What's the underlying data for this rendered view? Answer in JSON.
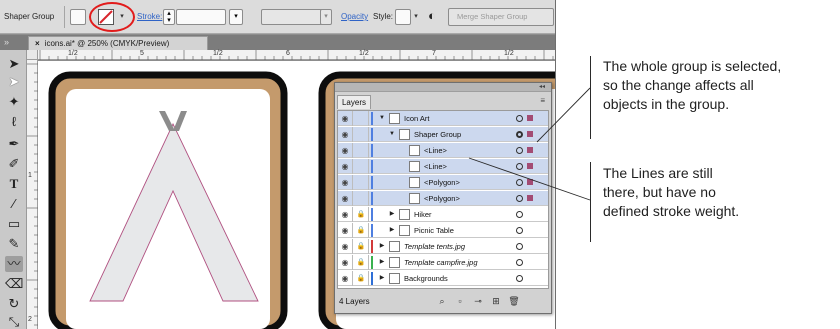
{
  "control_bar": {
    "selection_label": "Shaper Group",
    "stroke_label": "Stroke:",
    "opacity_label": "Opacity",
    "style_label": "Style:",
    "merge_button": "Merge Shaper Group"
  },
  "document": {
    "tab_title": "icons.ai* @ 250% (CMYK/Preview)"
  },
  "rulers": {
    "top_labels": [
      "1/2",
      "5",
      "1/2",
      "6",
      "1/2",
      "7",
      "1/2"
    ],
    "left_labels": [
      "1",
      "2"
    ]
  },
  "tools": {
    "icons": [
      "selection-tool-icon",
      "direct-selection-tool-icon",
      "magic-wand-icon",
      "lasso-icon",
      "pen-tool-icon",
      "curvature-tool-icon",
      "type-tool-icon",
      "line-tool-icon",
      "rectangle-tool-icon",
      "paintbrush-icon",
      "shaper-tool-icon",
      "eraser-icon",
      "rotate-tool-icon",
      "scale-tool-icon"
    ]
  },
  "layers_panel": {
    "tab_label": "Layers",
    "rows": [
      {
        "name": "Icon Art",
        "level": 0,
        "twist": "open",
        "lock": false,
        "italic": false,
        "color": "#4f7fe0",
        "selected": true
      },
      {
        "name": "Shaper Group",
        "level": 1,
        "twist": "open",
        "lock": false,
        "italic": false,
        "color": "#4f7fe0",
        "selected": true
      },
      {
        "name": "<Line>",
        "level": 2,
        "twist": "",
        "lock": false,
        "italic": false,
        "color": "#4f7fe0",
        "selected": true
      },
      {
        "name": "<Line>",
        "level": 2,
        "twist": "",
        "lock": false,
        "italic": false,
        "color": "#4f7fe0",
        "selected": true
      },
      {
        "name": "<Polygon>",
        "level": 2,
        "twist": "",
        "lock": false,
        "italic": false,
        "color": "#4f7fe0",
        "selected": true
      },
      {
        "name": "<Polygon>",
        "level": 2,
        "twist": "",
        "lock": false,
        "italic": false,
        "color": "#4f7fe0",
        "selected": true
      },
      {
        "name": "Hiker",
        "level": 1,
        "twist": "closed",
        "lock": true,
        "italic": false,
        "color": "#4f7fe0",
        "selected": false
      },
      {
        "name": "Picnic Table",
        "level": 1,
        "twist": "closed",
        "lock": true,
        "italic": false,
        "color": "#4f7fe0",
        "selected": false
      },
      {
        "name": "Template tents.jpg",
        "level": 0,
        "twist": "closed",
        "lock": true,
        "italic": true,
        "color": "#d23a3a",
        "selected": false
      },
      {
        "name": "Template campfire.jpg",
        "level": 0,
        "twist": "closed",
        "lock": true,
        "italic": true,
        "color": "#3ab14f",
        "selected": false
      },
      {
        "name": "Backgrounds",
        "level": 0,
        "twist": "closed",
        "lock": true,
        "italic": false,
        "color": "#2f6fd6",
        "selected": false
      }
    ],
    "footer_count": "4 Layers"
  },
  "callouts": {
    "top": [
      "The whole group is selected,",
      "so the change affects all",
      "objects in the group."
    ],
    "bottom": [
      "The Lines are still",
      "there, but have no",
      "defined stroke weight."
    ]
  },
  "colors": {
    "accent_red": "#e21b1b",
    "artboard_tan": "#c49a6c",
    "selection_magenta": "#b05080"
  }
}
